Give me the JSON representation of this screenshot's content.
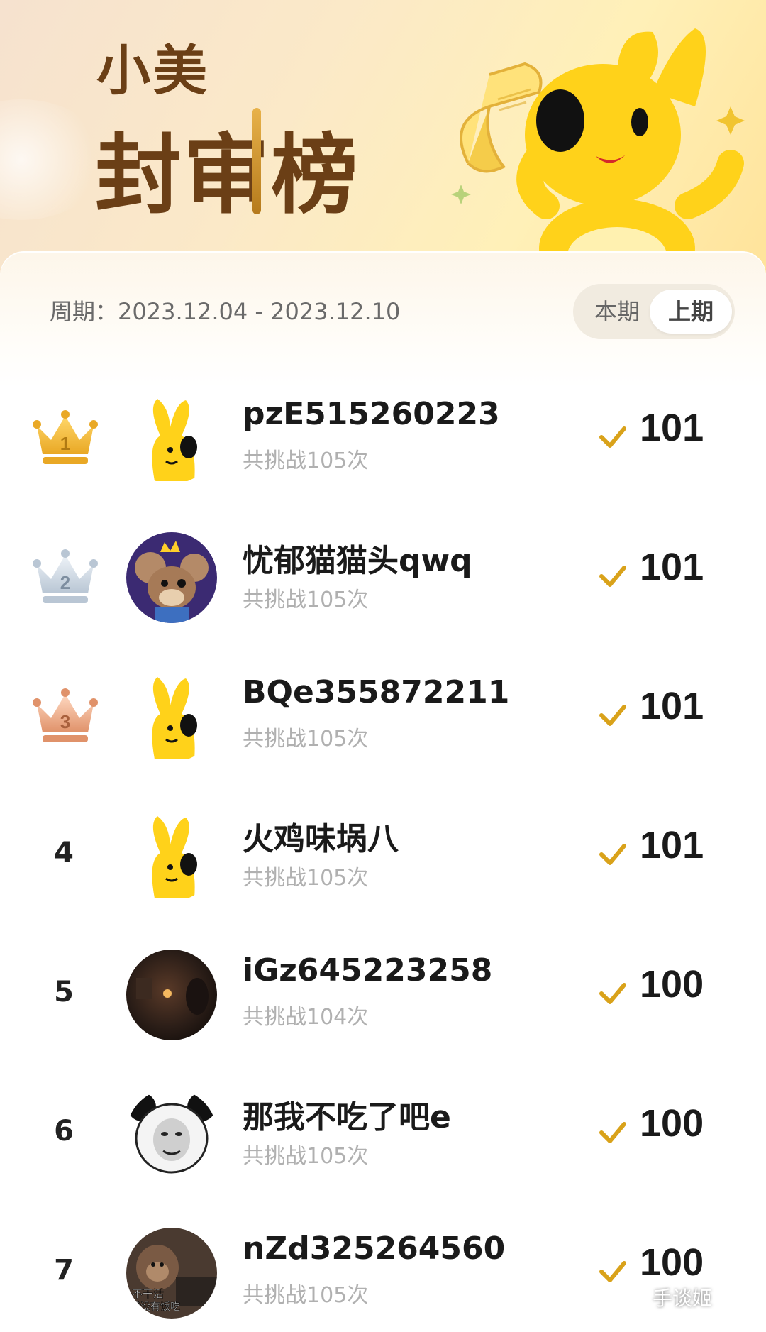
{
  "header": {
    "title_line1": "小美",
    "title_line2": "封审榜"
  },
  "period": {
    "label": "周期：",
    "range": "2023.12.04 - 2023.12.10"
  },
  "toggle": {
    "current": "本期",
    "previous": "上期",
    "selected": "上期"
  },
  "colors": {
    "accent_gold": "#d9a21a",
    "title_brown": "#6b3f16",
    "mascot_yellow": "#ffd21a"
  },
  "leaderboard": [
    {
      "rank": "1",
      "badge": "gold-crown-icon",
      "name": "pzE515260223",
      "challenges": "共挑战105次",
      "score": "101",
      "avatar": "yellow-mascot"
    },
    {
      "rank": "2",
      "badge": "silver-crown-icon",
      "name": "忧郁猫猫头qwq",
      "challenges": "共挑战105次",
      "score": "101",
      "avatar": "cartoon-mouse-with-crown"
    },
    {
      "rank": "3",
      "badge": "bronze-crown-icon",
      "name": "BQe355872211",
      "challenges": "共挑战105次",
      "score": "101",
      "avatar": "yellow-mascot"
    },
    {
      "rank": "4",
      "badge": "",
      "name": "火鸡味埚八",
      "challenges": "共挑战105次",
      "score": "101",
      "avatar": "yellow-mascot"
    },
    {
      "rank": "5",
      "badge": "",
      "name": "iGz645223258",
      "challenges": "共挑战104次",
      "score": "100",
      "avatar": "dark-photo"
    },
    {
      "rank": "6",
      "badge": "",
      "name": "那我不吃了吧e",
      "challenges": "共挑战105次",
      "score": "100",
      "avatar": "panda-meme"
    },
    {
      "rank": "7",
      "badge": "",
      "name": "nZd325264560",
      "challenges": "共挑战105次",
      "score": "100",
      "avatar": "monkey-meme",
      "avatar_text": [
        "不干活",
        "就没有饭吃"
      ]
    }
  ],
  "watermark": "手谈姬"
}
